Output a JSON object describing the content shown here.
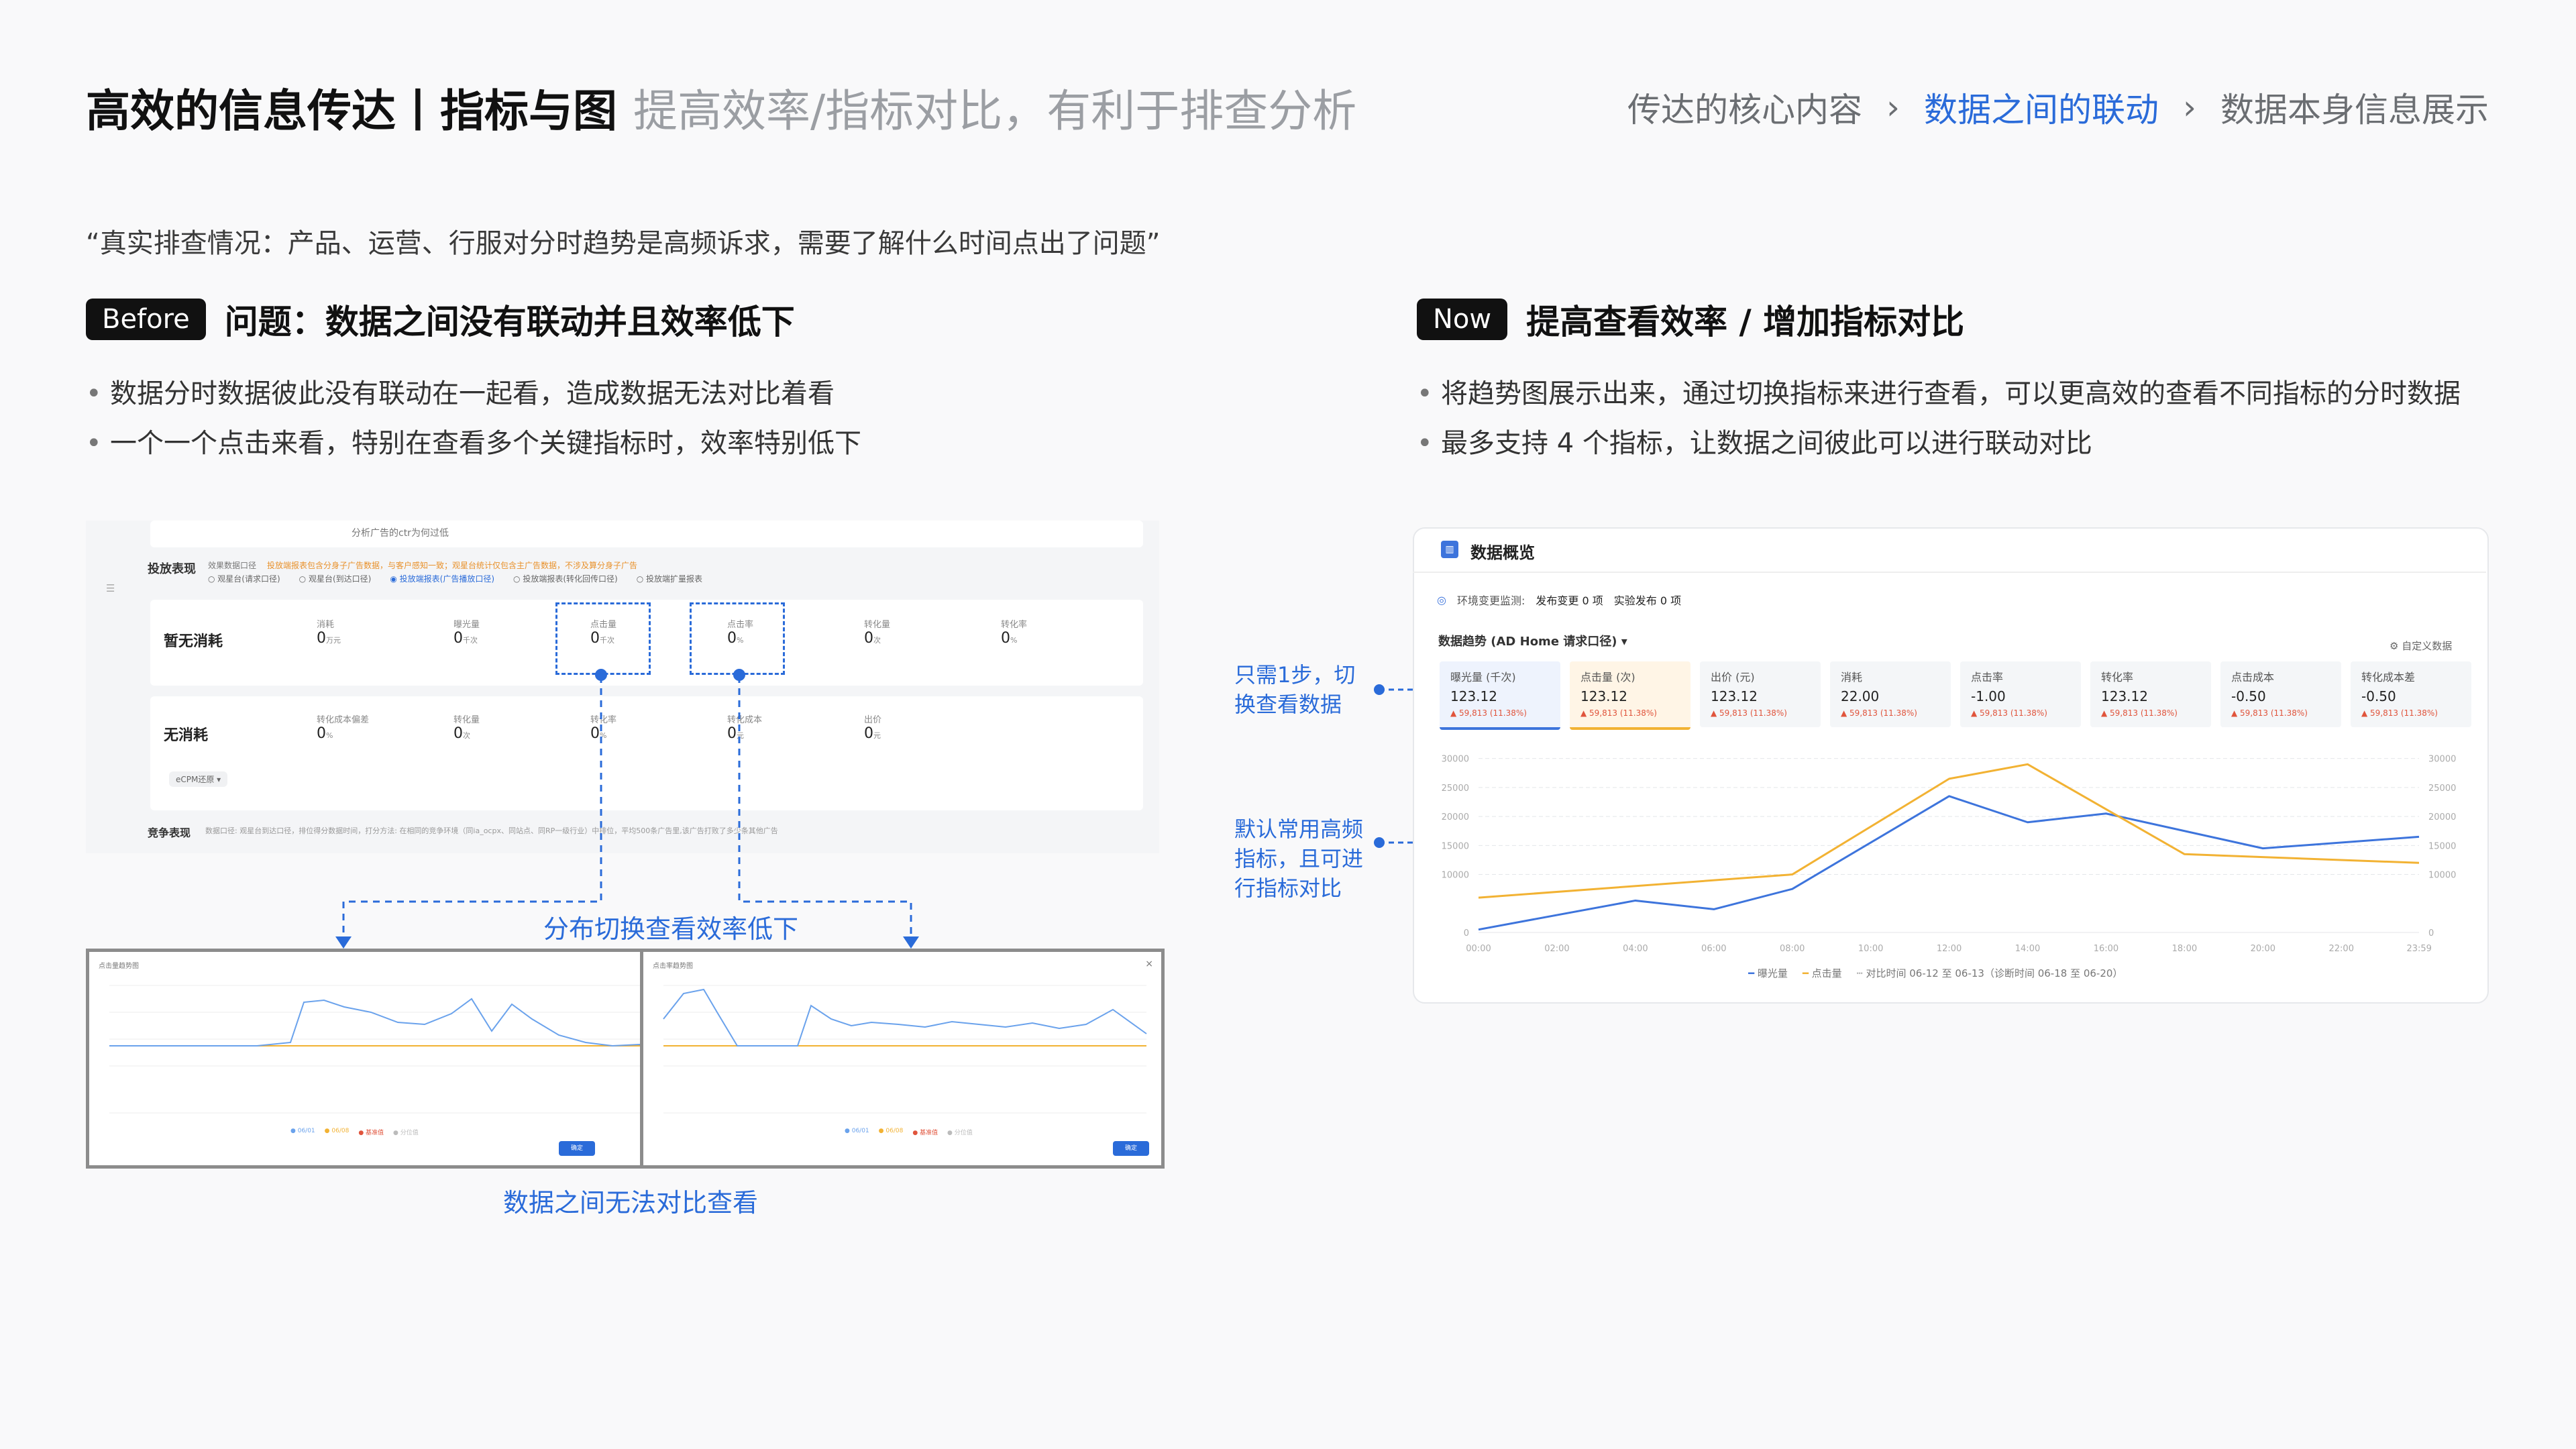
{
  "header": {
    "title": "高效的信息传达丨指标与图",
    "subtitle": "提高效率/指标对比，有利于排查分析",
    "breadcrumb": [
      "传达的核心内容",
      "数据之间的联动",
      "数据本身信息展示"
    ],
    "breadcrumb_active": 1
  },
  "quote": "“真实排查情况：产品、运营、行服对分时趋势是高频诉求，需要了解什么时间点出了问题”",
  "before": {
    "tag": "Before",
    "heading": "问题：数据之间没有联动并且效率低下",
    "bullets": [
      "数据分时数据彼此没有联动在一起看，造成数据无法对比着看",
      "一个一个点击来看，特别在查看多个关键指标时，效率特别低下"
    ],
    "mock": {
      "top_text": "分析广告的ctr为何过低",
      "section_label": "投放表现",
      "caliber_label": "效果数据口径",
      "notice": "投放端报表包含分身子广告数据，与客户感知一致；观星台统计仅包含主广告数据，不涉及算分身子广告",
      "radios": [
        "观星台(请求口径)",
        "观星台(到达口径)",
        "投放端报表(广告播放口径)",
        "投放端报表(转化回传口径)",
        "投放端扩量报表"
      ],
      "radio_selected": 2,
      "row1": {
        "label": "暂无消耗",
        "metrics": [
          {
            "name": "消耗",
            "value": "0",
            "unit": "万元"
          },
          {
            "name": "曝光量",
            "value": "0",
            "unit": "千次"
          },
          {
            "name": "点击量",
            "value": "0",
            "unit": "千次"
          },
          {
            "name": "点击率",
            "value": "0",
            "unit": "%"
          },
          {
            "name": "转化量",
            "value": "0",
            "unit": "次"
          },
          {
            "name": "转化率",
            "value": "0",
            "unit": "%"
          }
        ]
      },
      "row2": {
        "label": "无消耗",
        "metrics": [
          {
            "name": "转化成本偏差",
            "value": "0",
            "unit": "%"
          },
          {
            "name": "转化量",
            "value": "0",
            "unit": "次"
          },
          {
            "name": "转化率",
            "value": "0",
            "unit": "%"
          },
          {
            "name": "转化成本",
            "value": "0",
            "unit": "元"
          },
          {
            "name": "出价",
            "value": "0",
            "unit": "元"
          }
        ],
        "select": "eCPM还原"
      },
      "bottom_label": "竞争表现",
      "bottom_text": "数据口径: 观星台到达口径，排位得分数据时间，打分方法: 在相同的竞争环境（同ia_ocpx、同站点、同RP一级行业）中排位，平均500条广告里,该广告打败了多少条其他广告",
      "annotation_switch": "分布切换查看效率低下",
      "annotation_compare": "数据之间无法对比查看",
      "chart1_title": "点击量趋势图",
      "chart2_title": "点击率趋势图",
      "chart_button": "确定",
      "chart_legend": [
        "06/01",
        "06/08",
        "基准值",
        "分位值"
      ]
    }
  },
  "now": {
    "tag": "Now",
    "heading": "提高查看效率 / 增加指标对比",
    "bullets": [
      "将趋势图展示出来，通过切换指标来进行查看，可以更高效的查看不同指标的分时数据",
      "最多支持 4 个指标，让数据之间彼此可以进行联动对比"
    ],
    "annotation1": [
      "只需1步，切",
      "换查看数据"
    ],
    "annotation2": [
      "默认常用高频",
      "指标，且可进",
      "行指标对比"
    ],
    "card": {
      "title": "数据概览",
      "env_label": "环境变更监测:",
      "env_items": [
        "发布变更 0 项",
        "实验发布 0 项"
      ],
      "trend_label": "数据趋势 (AD Home 请求口径)",
      "custom_label": "自定义数据",
      "kpis": [
        {
          "name": "曝光量 (千次)",
          "value": "123.12",
          "change": "▲ 59,813 (11.38%)"
        },
        {
          "name": "点击量 (次)",
          "value": "123.12",
          "change": "▲ 59,813 (11.38%)"
        },
        {
          "name": "出价 (元)",
          "value": "123.12",
          "change": "▲ 59,813 (11.38%)"
        },
        {
          "name": "消耗",
          "value": "22.00",
          "change": "▲ 59,813 (11.38%)"
        },
        {
          "name": "点击率",
          "value": "-1.00",
          "change": "▲ 59,813 (11.38%)"
        },
        {
          "name": "转化率",
          "value": "123.12",
          "change": "▲ 59,813 (11.38%)"
        },
        {
          "name": "点击成本",
          "value": "-0.50",
          "change": "▲ 59,813 (11.38%)"
        },
        {
          "name": "转化成本差",
          "value": "-0.50",
          "change": "▲ 59,813 (11.38%)"
        }
      ],
      "legend": [
        "曝光量",
        "点击量",
        "对比时间 06-12 至 06-13（诊断时间 06-18 至 06-20）"
      ]
    }
  },
  "colors": {
    "accent_blue": "#2a6bd9",
    "series_blue": "#3d74dc",
    "series_orange": "#f2b233",
    "dark_tag": "#111111"
  },
  "chart_data": {
    "type": "line",
    "x": [
      "00:00",
      "02:00",
      "04:00",
      "06:00",
      "08:00",
      "10:00",
      "12:00",
      "14:00",
      "16:00",
      "18:00",
      "20:00",
      "22:00",
      "23:59"
    ],
    "x_ticks_shown": [
      "00:00",
      "02:00",
      "04:00",
      "06:00",
      "08:00",
      "10:00",
      "12:00",
      "14:00",
      "16:00",
      "18:00",
      "20:00",
      "22:00",
      "23:59"
    ],
    "series": [
      {
        "name": "曝光量",
        "color": "#3d74dc",
        "points": [
          [
            0,
            500
          ],
          [
            4,
            5500
          ],
          [
            6,
            4000
          ],
          [
            8,
            7500
          ],
          [
            12,
            23500
          ],
          [
            14,
            19000
          ],
          [
            16,
            20500
          ],
          [
            20,
            14500
          ],
          [
            23.98,
            16500
          ]
        ]
      },
      {
        "name": "点击量",
        "color": "#f2b233",
        "points": [
          [
            0,
            6000
          ],
          [
            8,
            10000
          ],
          [
            12,
            26500
          ],
          [
            14,
            29000
          ],
          [
            18,
            13500
          ],
          [
            23.98,
            12000
          ]
        ]
      }
    ],
    "yticks": [
      0,
      10000,
      15000,
      20000,
      25000,
      30000
    ],
    "ylim": [
      0,
      31000
    ],
    "grid": true,
    "legend_position": "bottom"
  }
}
